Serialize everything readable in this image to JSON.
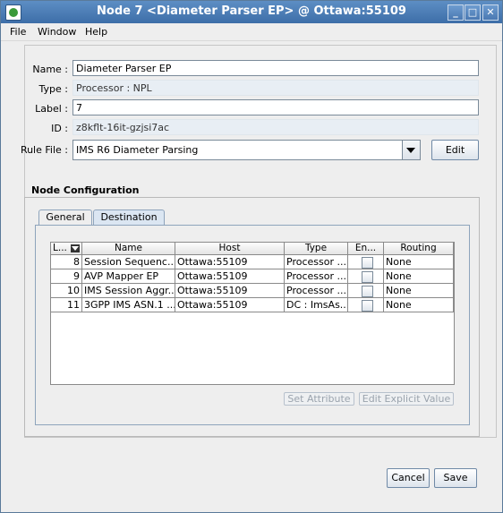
{
  "window": {
    "title": "Node 7 <Diameter Parser EP> @ Ottawa:55109",
    "controls": {
      "minimize": "_",
      "maximize": "□",
      "close": "✕"
    }
  },
  "menubar": [
    "File",
    "Window",
    "Help"
  ],
  "form": {
    "name": {
      "label": "Name :",
      "value": "Diameter Parser EP"
    },
    "type": {
      "label": "Type :",
      "value": "Processor : NPL"
    },
    "label": {
      "label": "Label :",
      "value": "7"
    },
    "id": {
      "label": "ID :",
      "value": "z8kflt-16it-gzjsi7ac"
    },
    "rule_file": {
      "label": "Rule File :",
      "value": "IMS R6 Diameter Parsing"
    },
    "edit_label": "Edit"
  },
  "node_config": {
    "title": "Node Configuration",
    "tabs": [
      "General",
      "Destination"
    ],
    "active_tab": "Destination",
    "table": {
      "columns": [
        "L...",
        "Name",
        "Host",
        "Type",
        "En...",
        "Routing"
      ],
      "rows": [
        {
          "l": "8",
          "name": "Session Sequenc...",
          "host": "Ottawa:55109",
          "type": "Processor ...",
          "enabled": false,
          "routing": "None"
        },
        {
          "l": "9",
          "name": "AVP Mapper EP",
          "host": "Ottawa:55109",
          "type": "Processor ...",
          "enabled": false,
          "routing": "None"
        },
        {
          "l": "10",
          "name": "IMS Session Aggr...",
          "host": "Ottawa:55109",
          "type": "Processor ...",
          "enabled": false,
          "routing": "None"
        },
        {
          "l": "11",
          "name": "3GPP IMS ASN.1 ...",
          "host": "Ottawa:55109",
          "type": "DC : ImsAs...",
          "enabled": false,
          "routing": "None"
        }
      ]
    },
    "set_attribute_label": "Set Attribute",
    "edit_explicit_label": "Edit Explicit Value"
  },
  "footer": {
    "cancel_label": "Cancel",
    "save_label": "Save"
  },
  "colors": {
    "titlebar": "#4a7bb5",
    "panel": "#eeeeee",
    "readonly_field": "#e8eef4"
  }
}
